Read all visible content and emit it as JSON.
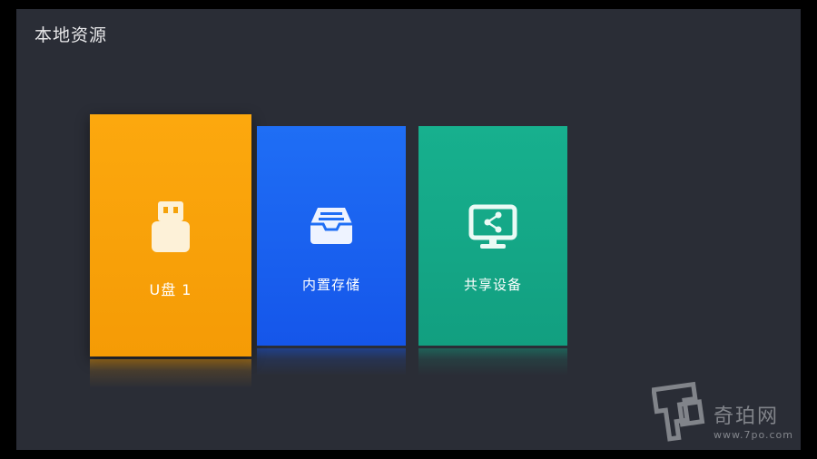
{
  "header": {
    "title": "本地资源"
  },
  "tiles": [
    {
      "id": "usb",
      "label": "U盘 1",
      "icon": "usb-drive-icon",
      "color": "#f59b05"
    },
    {
      "id": "internal",
      "label": "内置存储",
      "icon": "inbox-tray-icon",
      "color": "#1556ea"
    },
    {
      "id": "shared",
      "label": "共享设备",
      "icon": "share-monitor-icon",
      "color": "#129f80"
    }
  ],
  "watermark": {
    "name": "奇珀网",
    "url": "www.7po.com"
  },
  "colors": {
    "background": "#2a2d36",
    "title_text": "#e8e8ea"
  }
}
